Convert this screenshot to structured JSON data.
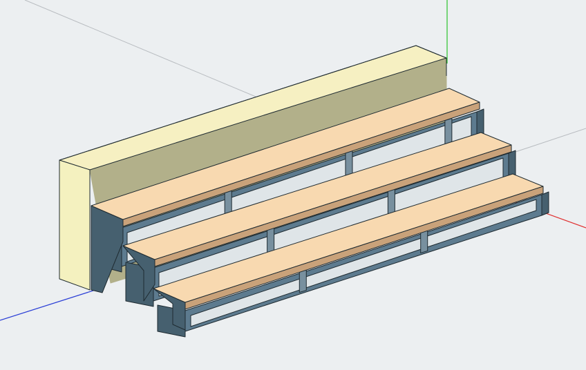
{
  "viewport": {
    "background": "#eceff1",
    "kind": "3d-model-viewport"
  },
  "axes": {
    "x_color": "#e03030",
    "y_color": "#29c229",
    "z_color": "#2b3fd6",
    "guide_color": "#b8bcc0"
  },
  "model": {
    "name": "bleacher-stand",
    "colors": {
      "back_wall_front": "#f4f1bf",
      "back_wall_top": "#f6f0c2",
      "back_wall_shadow": "#b2b08a",
      "seat_board_top": "#f8d9b0",
      "seat_board_front": "#c9a27a",
      "frame": "#5d7b8f",
      "frame_dark": "#46606f",
      "frame_light": "#78909f",
      "outline": "#1e2a30"
    },
    "tiers": 3
  }
}
